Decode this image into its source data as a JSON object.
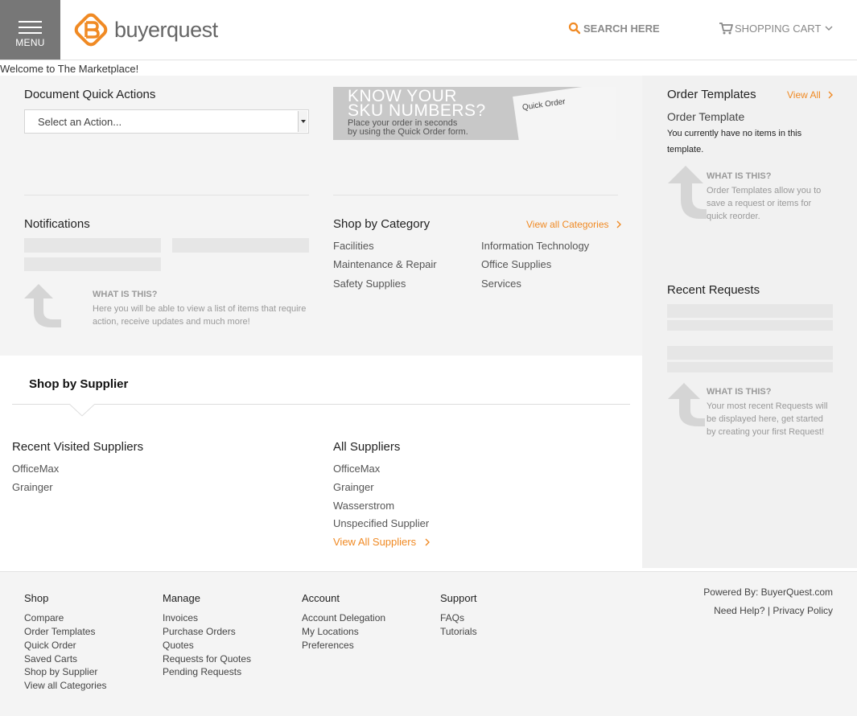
{
  "header": {
    "menu_label": "MENU",
    "logo_text": "buyerquest",
    "search_label": "SEARCH HERE",
    "cart_label": "SHOPPING CART"
  },
  "welcome": "Welcome to The Marketplace!",
  "quick_actions": {
    "title": "Document Quick Actions",
    "select_value": "Select an Action..."
  },
  "banner": {
    "line1": "KNOW YOUR",
    "line2": "SKU NUMBERS?",
    "line3": "Place your order in seconds",
    "line4": "by using the Quick Order form.",
    "paper_title": "Quick Order"
  },
  "notifications": {
    "title": "Notifications",
    "what_title": "WHAT IS THIS?",
    "what_text_1": "Here you will be able to view a list of items that require",
    "what_text_2": "action, receive updates and much more!"
  },
  "categories": {
    "title": "Shop by Category",
    "view_all": "View all Categories",
    "items": [
      "Facilities",
      "Information Technology",
      "Maintenance & Repair",
      "Office Supplies",
      "Safety Supplies",
      "Services"
    ]
  },
  "order_templates": {
    "title": "Order Templates",
    "view_all": "View All",
    "subtitle": "Order Template",
    "empty_1": "You currently have no items in this",
    "empty_2": "template.",
    "what_title": "WHAT IS THIS?",
    "what_text_1": "Order Templates allow you to",
    "what_text_2": "save a request or items for",
    "what_text_3": "quick reorder."
  },
  "recent_requests": {
    "title": "Recent Requests",
    "what_title": "WHAT IS THIS?",
    "what_text_1": "Your most recent Requests will",
    "what_text_2": "be displayed here, get started",
    "what_text_3": "by creating your first Request!"
  },
  "suppliers": {
    "tab": "Shop by Supplier",
    "recent_title": "Recent Visited Suppliers",
    "recent": [
      "OfficeMax",
      "Grainger"
    ],
    "all_title": "All Suppliers",
    "all": [
      "OfficeMax",
      "Grainger",
      "Wasserstrom",
      "Unspecified Supplier"
    ],
    "view_all": "View All Suppliers"
  },
  "footer": {
    "shop": {
      "title": "Shop",
      "links": [
        "Compare",
        "Order Templates",
        "Quick Order",
        "Saved Carts",
        "Shop by Supplier",
        "View all Categories"
      ]
    },
    "manage": {
      "title": "Manage",
      "links": [
        "Invoices",
        "Purchase Orders",
        "Quotes",
        "Requests for Quotes",
        "Pending Requests"
      ]
    },
    "account": {
      "title": "Account",
      "links": [
        "Account Delegation",
        "My Locations",
        "Preferences"
      ]
    },
    "support": {
      "title": "Support",
      "links": [
        "FAQs",
        "Tutorials"
      ]
    },
    "powered_by": "Powered By: BuyerQuest.com",
    "need_help": "Need Help?",
    "separator": "|",
    "privacy": "Privacy Policy"
  },
  "colors": {
    "accent": "#f08a24",
    "menu_bg": "#777777"
  }
}
